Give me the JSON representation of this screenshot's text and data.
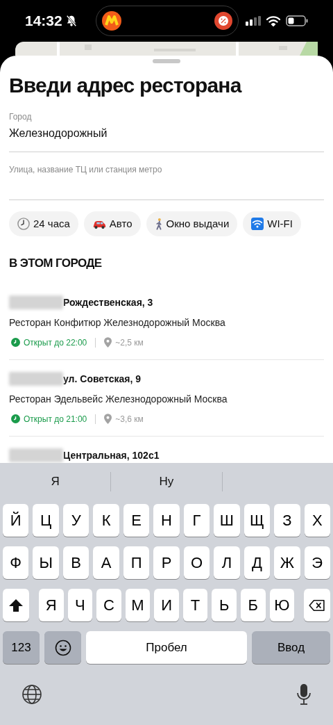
{
  "status_bar": {
    "time": "14:32",
    "silent": true
  },
  "sheet": {
    "title": "Введи адрес ресторана",
    "city_field": {
      "label": "Город",
      "value": "Железнодорожный"
    },
    "street_field": {
      "placeholder": "Улица, название ТЦ или станция метро"
    },
    "chips": [
      {
        "kind": "clock",
        "label": "24 часа"
      },
      {
        "kind": "car",
        "label": "Авто"
      },
      {
        "kind": "walker",
        "label": "Окно выдачи"
      },
      {
        "kind": "wifi",
        "label": "WI-FI"
      }
    ],
    "section_title": "В ЭТОМ ГОРОДЕ",
    "restaurants": [
      {
        "address": "Рождественская, 3",
        "name": "Ресторан Конфитюр Железнодорожный Москва",
        "status": "Открыт до 22:00",
        "distance": "~2,5 км"
      },
      {
        "address": "ул. Советская, 9",
        "name": "Ресторан Эдельвейс Железнодорожный Москва",
        "status": "Открыт до 21:00",
        "distance": "~3,6 км"
      },
      {
        "address": "Центральная, 102с1"
      }
    ]
  },
  "keyboard": {
    "suggestions": [
      "Я",
      "Ну"
    ],
    "top_row": [
      "Й",
      "Ц",
      "У",
      "К",
      "Е",
      "Н",
      "Г",
      "Ш",
      "Щ",
      "З",
      "Х"
    ],
    "middle_row": [
      "Ф",
      "Ы",
      "В",
      "А",
      "П",
      "Р",
      "О",
      "Л",
      "Д",
      "Ж",
      "Э"
    ],
    "bottom_row": [
      "Я",
      "Ч",
      "С",
      "М",
      "И",
      "Т",
      "Ь",
      "Б",
      "Ю"
    ],
    "numbers_key": "123",
    "space_key": "Пробел",
    "return_key": "Ввод"
  }
}
